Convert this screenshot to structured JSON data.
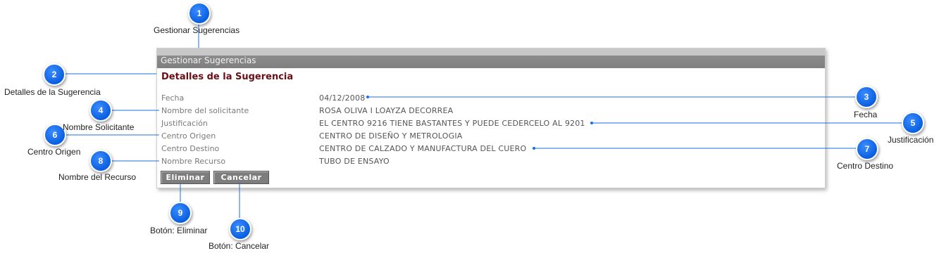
{
  "window": {
    "title": "Gestionar Sugerencias"
  },
  "section": {
    "title": "Detalles de la Sugerencia"
  },
  "fields": [
    {
      "label": "Fecha",
      "value": "04/12/2008"
    },
    {
      "label": "Nombre del solicitante",
      "value": "ROSA OLIVA I LOAYZA DECORREA"
    },
    {
      "label": "Justificación",
      "value": "EL CENTRO 9216 TIENE BASTANTES Y PUEDE CEDERCELO AL 9201"
    },
    {
      "label": "Centro Origen",
      "value": "CENTRO DE DISEÑO Y METROLOGIA"
    },
    {
      "label": "Centro Destino",
      "value": "CENTRO DE CALZADO Y MANUFACTURA DEL CUERO"
    },
    {
      "label": "Nombre Recurso",
      "value": "TUBO DE ENSAYO"
    }
  ],
  "buttons": {
    "delete": "Eliminar",
    "cancel": "Cancelar"
  },
  "callouts": [
    {
      "number": "1",
      "text": "Gestionar Sugerencias"
    },
    {
      "number": "2",
      "text": "Detalles de la Sugerencia"
    },
    {
      "number": "3",
      "text": "Fecha"
    },
    {
      "number": "4",
      "text": "Nombre Solicitante"
    },
    {
      "number": "5",
      "text": "Justificación"
    },
    {
      "number": "6",
      "text": "Centro Origen"
    },
    {
      "number": "7",
      "text": "Centro Destino"
    },
    {
      "number": "8",
      "text": "Nombre del Recurso"
    },
    {
      "number": "9",
      "text": "Botón: Eliminar"
    },
    {
      "number": "10",
      "text": "Botón: Cancelar"
    }
  ],
  "colors": {
    "badge": "#0a5fe0",
    "connector": "#1a6fe6",
    "section_title": "#6a0f16",
    "titlebar": "#7f7f7f"
  }
}
